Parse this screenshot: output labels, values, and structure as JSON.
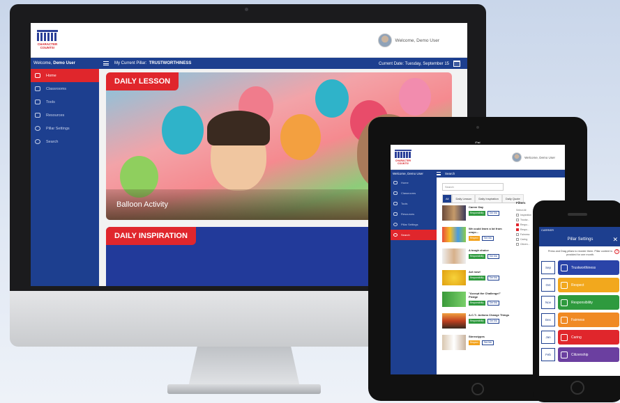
{
  "desktop": {
    "logo_text": "CHARACTER COUNTS!",
    "welcome_top": "Welcome, Demo User",
    "nav_welcome_prefix": "Welcome,",
    "nav_welcome_user": "Demo User",
    "pillar_label": "My Current Pillar:",
    "pillar_value": "TRUSTWORTHINESS",
    "date_text": "Current Date: Tuesday, September 15",
    "sidebar": [
      {
        "label": "Home",
        "icon": "home-icon"
      },
      {
        "label": "Classrooms",
        "icon": "classrooms-icon"
      },
      {
        "label": "Tools",
        "icon": "tools-icon"
      },
      {
        "label": "Resources",
        "icon": "resources-icon"
      },
      {
        "label": "Pillar Settings",
        "icon": "settings-icon"
      },
      {
        "label": "Search",
        "icon": "search-icon"
      }
    ],
    "card1_tag": "DAILY LESSON",
    "card1_caption": "Balloon Activity",
    "card2_tag": "DAILY INSPIRATION"
  },
  "tablet": {
    "status_text": "iPad",
    "welcome_top": "Welcome, Demo User",
    "nav_welcome": "Welcome, Demo User",
    "nav_section": "Search",
    "sidebar": [
      {
        "label": "Home"
      },
      {
        "label": "Classrooms"
      },
      {
        "label": "Tools"
      },
      {
        "label": "Resources"
      },
      {
        "label": "Pillar Settings"
      },
      {
        "label": "Search"
      }
    ],
    "search_placeholder": "Search",
    "tabs": [
      "All",
      "Daily Lesson",
      "Daily Inspiration",
      "Daily Quote"
    ],
    "results": [
      {
        "title": "Career Day",
        "badge": "Responsibility",
        "badge_color": "#2e9a3e",
        "view": "See link"
      },
      {
        "title": "We could learn a lot from crayo...",
        "badge": "Respect",
        "badge_color": "#f3a21c",
        "view": "See link"
      },
      {
        "title": "A tough choice",
        "badge": "Responsibility",
        "badge_color": "#2e9a3e",
        "view": "See link"
      },
      {
        "title": "Act now!",
        "badge": "Responsibility",
        "badge_color": "#2e9a3e",
        "view": "See link"
      },
      {
        "title": "\"Accept the Challenge!\" Pledge",
        "badge": "Responsibility",
        "badge_color": "#2e9a3e",
        "view": "See link"
      },
      {
        "title": "A.C.T.: Actions Change Things",
        "badge": "Responsibility",
        "badge_color": "#2e9a3e",
        "view": "See link"
      },
      {
        "title": "Stereotypes",
        "badge": "Respect",
        "badge_color": "#f3a21c",
        "view": "See link"
      }
    ],
    "filters_title": "Filters",
    "filter_items": [
      "Select All",
      "Inspiration",
      "Trustw...",
      "Respo...",
      "Respo...",
      "Fairness",
      "Caring",
      "Citizen..."
    ]
  },
  "phone": {
    "status_text": "CARRIER",
    "header": "Pillar Settings",
    "close": "✕",
    "note": "Press and Drag pillars to reorder them. Pillar content is provided for one month.",
    "help": "?",
    "rows": [
      {
        "month": "Sep",
        "pillar": "Trustworthiness",
        "color": "#2a44a8"
      },
      {
        "month": "Oct",
        "pillar": "Respect",
        "color": "#f2a81d"
      },
      {
        "month": "Nov",
        "pillar": "Responsibility",
        "color": "#2e9a3e"
      },
      {
        "month": "Dec",
        "pillar": "Fairness",
        "color": "#f08a24"
      },
      {
        "month": "Jan",
        "pillar": "Caring",
        "color": "#e0262c"
      },
      {
        "month": "Feb",
        "pillar": "Citizenship",
        "color": "#6b3fa0"
      }
    ]
  }
}
